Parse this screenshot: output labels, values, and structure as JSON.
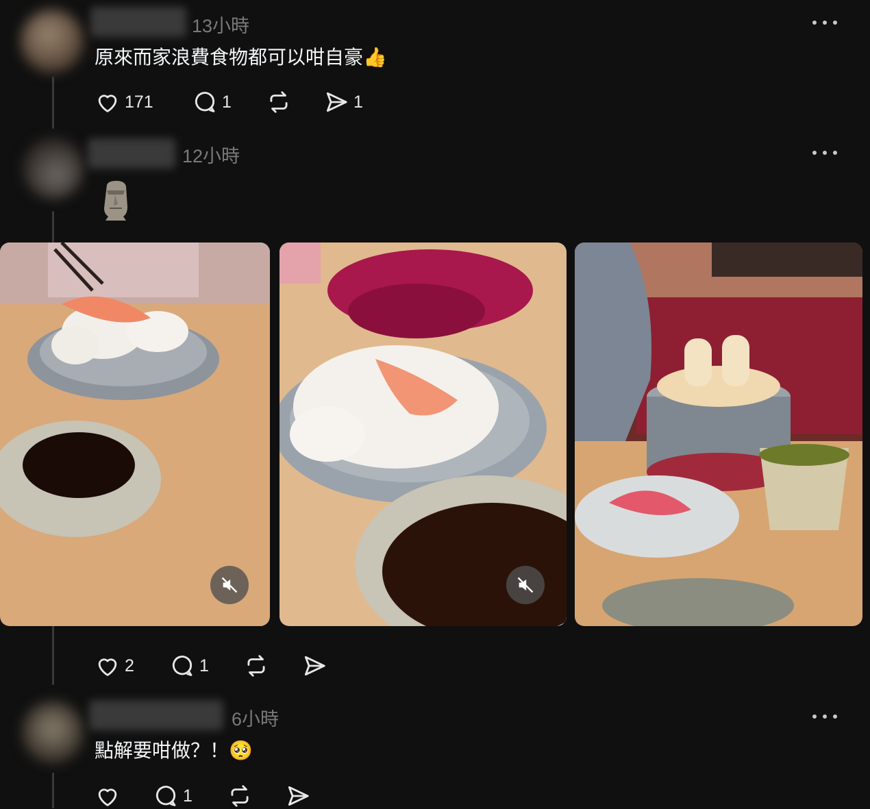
{
  "posts": [
    {
      "time": "13小時",
      "text": "原來而家浪費食物都可以咁自豪👍",
      "likes": "171",
      "replies": "1",
      "reposts": "",
      "shares": "1"
    },
    {
      "time": "12小時",
      "text": "",
      "emoji": "moai-icon",
      "likes": "2",
      "replies": "1",
      "reposts": "",
      "shares": ""
    },
    {
      "time": "6小時",
      "text": "點解要咁做？！🥺",
      "likes": "",
      "replies": "1",
      "reposts": "",
      "shares": ""
    }
  ],
  "colors": {
    "background": "#101010",
    "text": "#f3f5f7",
    "muted": "#7a7a7a",
    "thread_line": "#3a3a3a"
  }
}
